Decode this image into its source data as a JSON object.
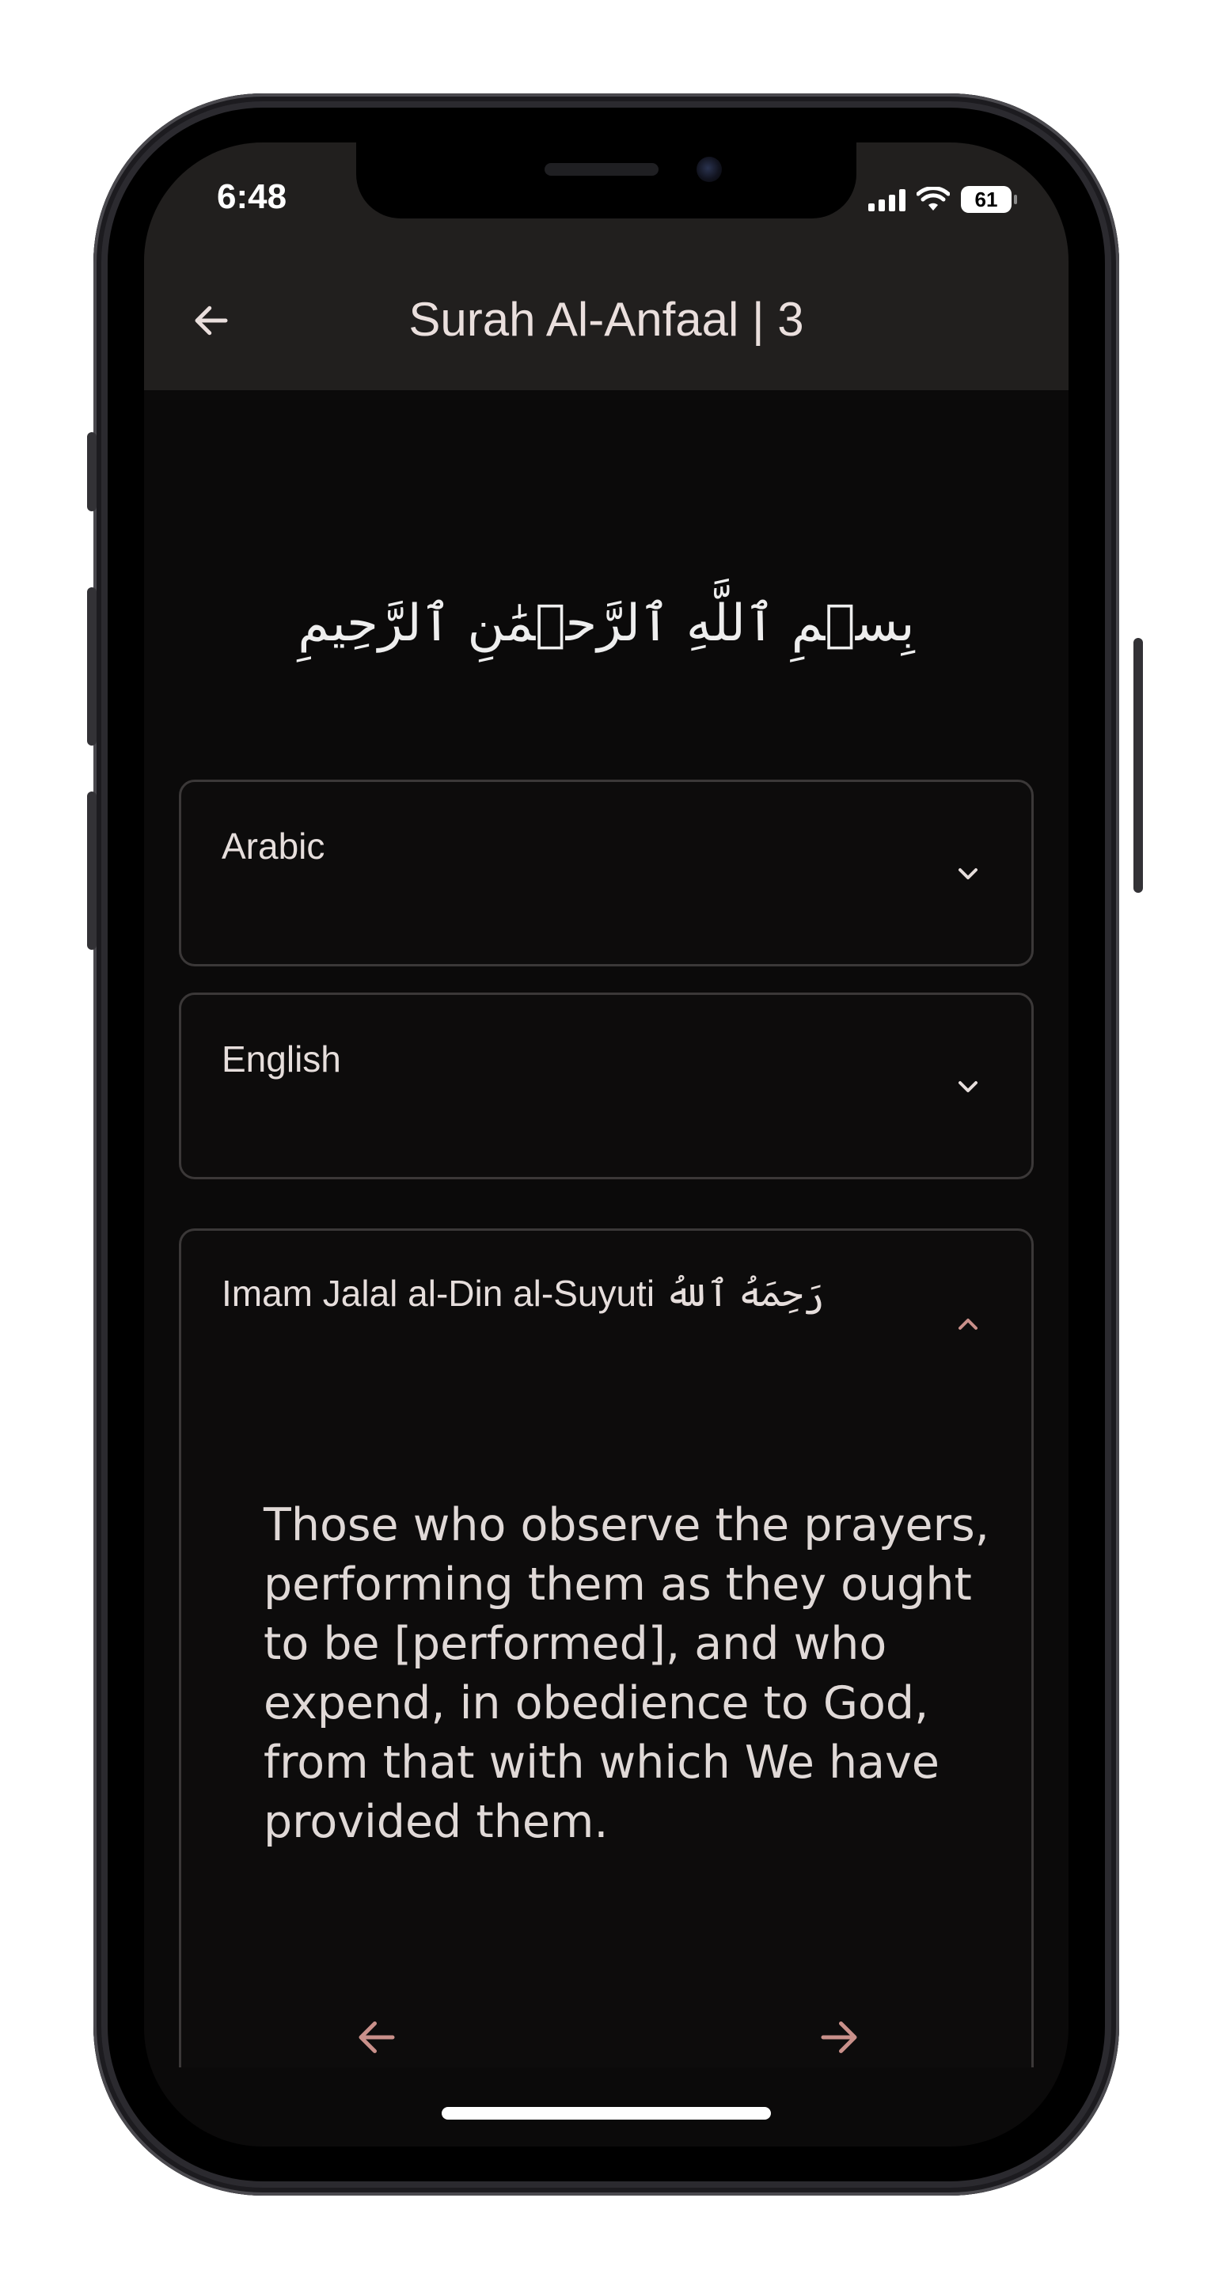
{
  "status_bar": {
    "time": "6:48",
    "battery": "61",
    "icons": [
      "cellular-signal-icon",
      "wifi-icon",
      "battery-icon"
    ]
  },
  "header": {
    "title": "Surah Al-Anfaal | 3",
    "back_icon": "arrow-left-icon"
  },
  "bismillah": "بِسۡمِ ٱللَّهِ ٱلرَّحۡمَٰنِ ٱلرَّحِيمِ",
  "sections": [
    {
      "label": "Arabic",
      "state": "collapsed",
      "icon": "chevron-down-icon"
    },
    {
      "label": "English",
      "state": "collapsed",
      "icon": "chevron-down-icon"
    },
    {
      "label": "Imam Jalal al-Din al-Suyuti رَحِمَهُ ٱللهُ",
      "state": "expanded",
      "icon": "chevron-up-icon",
      "content": "Those who observe the prayers, performing them as they ought to be [performed], and who expend, in obedience to God, from that with which We have provided them."
    }
  ],
  "bottom_nav": {
    "previous_icon": "arrow-left-icon",
    "next_icon": "arrow-right-icon"
  },
  "colors": {
    "background": "#0b0a0a",
    "app_bar": "#211f1e",
    "accent": "#c9908a",
    "text": "#e6dedc",
    "card_border": "#3b3838"
  }
}
